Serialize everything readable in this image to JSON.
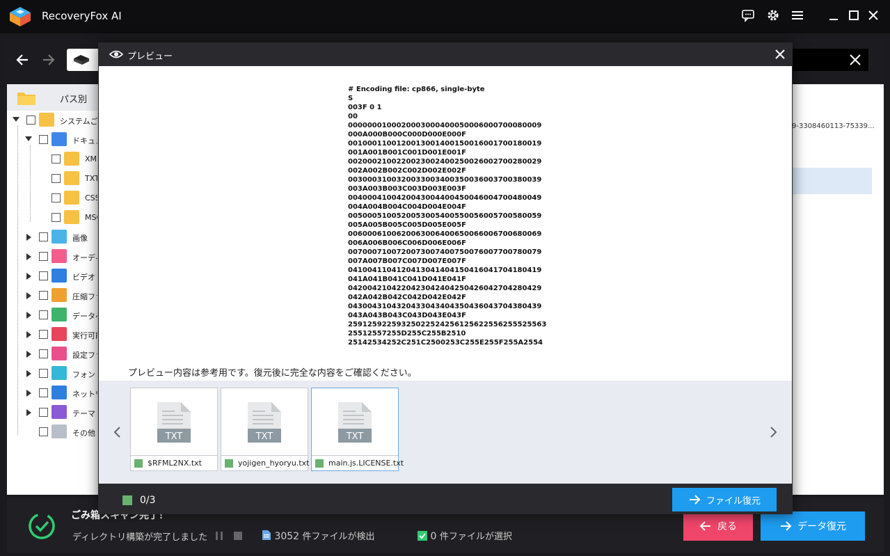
{
  "app": {
    "title": "RecoveryFox AI"
  },
  "tree": {
    "header": "パス別",
    "items": [
      {
        "label": "システムごみ箱",
        "level": 0,
        "expand": "down",
        "icon_color": "#f7c143"
      },
      {
        "label": "ドキュメント",
        "level": 1,
        "expand": "down",
        "icon_color": "#3f86e8"
      },
      {
        "label": "XML",
        "level": 2,
        "expand": "none",
        "icon_color": "#f7c143"
      },
      {
        "label": "TXT",
        "level": 2,
        "expand": "none",
        "icon_color": "#f7c143"
      },
      {
        "label": "CSS",
        "level": 2,
        "expand": "none",
        "icon_color": "#f7c143"
      },
      {
        "label": "MSG",
        "level": 2,
        "expand": "none",
        "icon_color": "#f7c143"
      },
      {
        "label": "画像",
        "level": 1,
        "expand": "right",
        "icon_color": "#4bb4e6"
      },
      {
        "label": "オーディオ",
        "level": 1,
        "expand": "right",
        "icon_color": "#f25d8e"
      },
      {
        "label": "ビデオ",
        "level": 1,
        "expand": "right",
        "icon_color": "#2f7fe0"
      },
      {
        "label": "圧縮ファイル",
        "level": 1,
        "expand": "right",
        "icon_color": "#f0a030"
      },
      {
        "label": "データベース",
        "level": 1,
        "expand": "right",
        "icon_color": "#3db36b"
      },
      {
        "label": "実行可能",
        "level": 1,
        "expand": "right",
        "icon_color": "#e8455c"
      },
      {
        "label": "設定ファイル",
        "level": 1,
        "expand": "right",
        "icon_color": "#e94f8b"
      },
      {
        "label": "フォント",
        "level": 1,
        "expand": "right",
        "icon_color": "#35b8d8"
      },
      {
        "label": "ネットワーク",
        "level": 1,
        "expand": "right",
        "icon_color": "#2f7fe0"
      },
      {
        "label": "テーマ",
        "level": 1,
        "expand": "right",
        "icon_color": "#8a5bd6"
      },
      {
        "label": "その他",
        "level": 1,
        "expand": "none",
        "icon_color": "#b9bfc8"
      }
    ]
  },
  "right_col": {
    "snippet": "9-3308460113-75339..."
  },
  "modal": {
    "title": "プレビュー",
    "preview_text": "# Encoding file: cp866, single-byte\nS\n003F 0 1\n00\n0000000100020003000400050006000700080009\n000A000B000C000D000E000F\n0010001100120013001400150016001700180019\n001A001B001C001D001E001F\n0020002100220023002400250026002700280029\n002A002B002C002D002E002F\n0030003100320033003400350036003700380039\n003A003B003C003D003E003F\n0040004100420043004400450046004700480049\n004A004B004C004D004E004F\n0050005100520053005400550056005700580059\n005A005B005C005D005E005F\n0060006100620063006400650066006700680069\n006A006B006C006D006E006F\n0070007100720073007400750076007700780079\n007A007B007C007D007E007F\n0410041104120413041404150416041704180419\n041A041B041C041D041E041F\n0420042104220423042404250426042704280429\n042A042B042C042D042E042F\n0430043104320433043404350436043704380439\n043A043B043C043D043E043F\n25912592259325022524256125622556255525563\n25512557255D255C255B2510\n25142534252C251C2500253C255E255F255A2554",
    "note": "プレビュー内容は参考用です。復元後に完全な内容をご確認ください。",
    "thumbs": [
      {
        "label": "TXT",
        "name": "$RFML2NX.txt"
      },
      {
        "label": "TXT",
        "name": "yojigen_hyoryu.txt"
      },
      {
        "label": "TXT",
        "name": "main.js.LICENSE.txt"
      }
    ],
    "selected_count": "0/3",
    "recover_button": "ファイル復元"
  },
  "bottom": {
    "scan_title": "ごみ箱スキャン完了！",
    "scan_status": "ディレクトリ構築が完了しました",
    "found_count": "3052",
    "found_suffix": "件ファイルが検出",
    "selected_count": "0",
    "selected_suffix": "件ファイルが選択",
    "back_button": "戻る",
    "recover_button": "データ復元"
  },
  "colors": {
    "accent": "#1e9cf0",
    "back": "#f0466a",
    "success": "#2ecc71"
  }
}
